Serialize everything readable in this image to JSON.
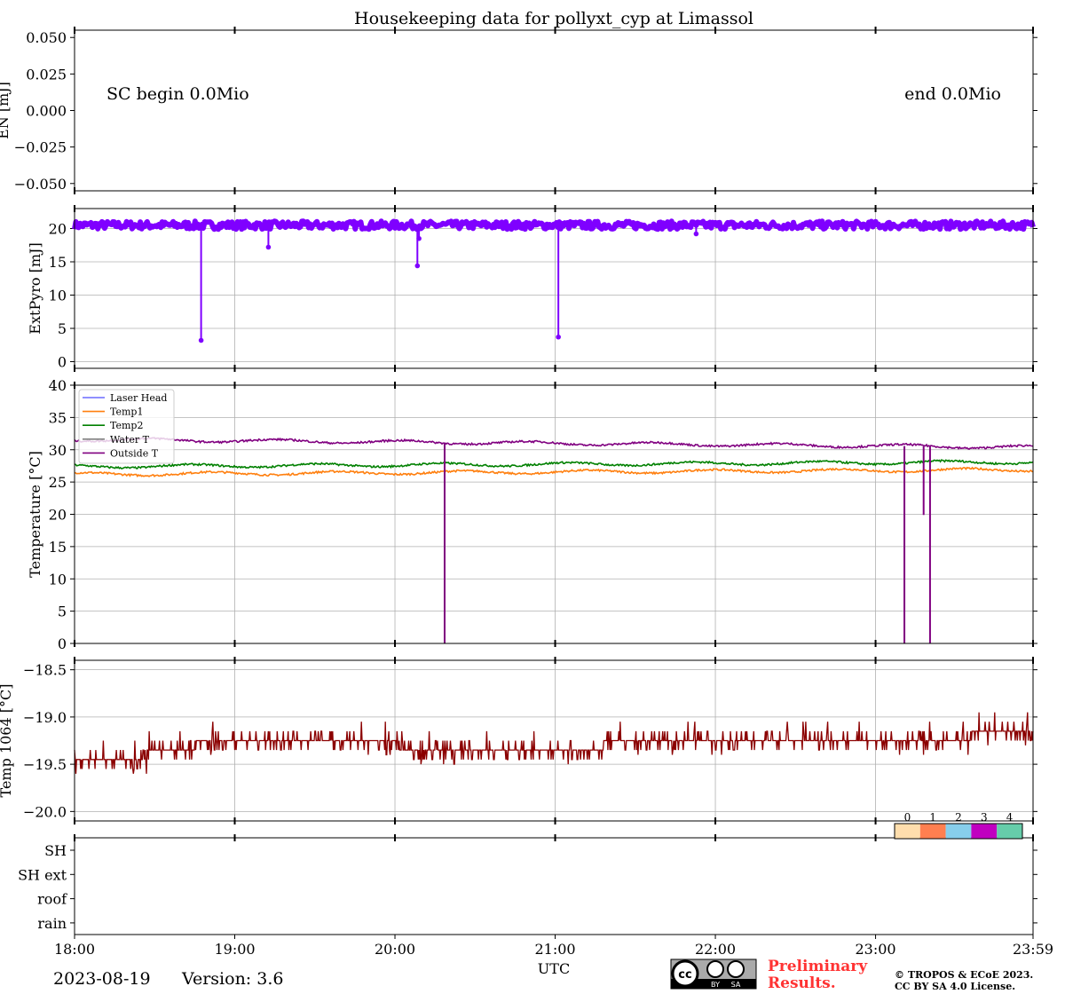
{
  "title": "Housekeeping data for pollyxt_cyp at Limassol",
  "date_label": "2023-08-19",
  "version_label": "Version: 3.6",
  "x_axis": {
    "label": "UTC",
    "ticks": [
      "18:00",
      "19:00",
      "20:00",
      "21:00",
      "22:00",
      "23:00",
      "23:59"
    ],
    "tick_hours": [
      18,
      19,
      20,
      21,
      22,
      23,
      23.983
    ],
    "range_hours": [
      18,
      23.983
    ]
  },
  "footer": {
    "preliminary": "Preliminary\nResults.",
    "copyright": "© TROPOS & ECoE 2023.",
    "license": "CC BY SA 4.0 License.",
    "cc_badge_by": "BY",
    "cc_badge_sa": "SA",
    "colors": {
      "preliminary": "#ff3333"
    }
  },
  "chart_data": [
    {
      "type": "line",
      "ylabel": "EN [mJ]",
      "ylim": [
        -0.055,
        0.055
      ],
      "yticks": [
        -0.05,
        -0.025,
        0.0,
        0.025,
        0.05
      ],
      "ytick_labels": [
        "−0.050",
        "−0.025",
        "0.000",
        "0.025",
        "0.050"
      ],
      "grid": false,
      "annotations": [
        "SC begin 0.0Mio",
        "end 0.0Mio"
      ],
      "series": []
    },
    {
      "type": "line",
      "ylabel": "ExtPyro [mJ]",
      "ylim": [
        -1,
        23
      ],
      "yticks": [
        0,
        5,
        10,
        15,
        20
      ],
      "ytick_labels": [
        "0",
        "5",
        "10",
        "15",
        "20"
      ],
      "grid": true,
      "color": "#7f00ff",
      "baseline": 20.5,
      "dips": [
        {
          "x": 18.79,
          "y": 3.2
        },
        {
          "x": 19.21,
          "y": 17.2
        },
        {
          "x": 20.14,
          "y": 14.4
        },
        {
          "x": 20.15,
          "y": 18.5
        },
        {
          "x": 21.02,
          "y": 3.7
        },
        {
          "x": 21.88,
          "y": 19.2
        }
      ]
    },
    {
      "type": "line",
      "ylabel": "Temperature [$^\\circ$C]",
      "ylim": [
        0,
        40
      ],
      "yticks": [
        0,
        5,
        10,
        15,
        20,
        25,
        30,
        35,
        40
      ],
      "ytick_labels": [
        "0",
        "5",
        "10",
        "15",
        "20",
        "25",
        "30",
        "35",
        "40"
      ],
      "grid": true,
      "legend_position": "top-left",
      "series": [
        {
          "name": "Laser Head",
          "color": "#6b6bff",
          "values": []
        },
        {
          "name": "Temp1",
          "color": "#ff7f0e",
          "start": 26.2,
          "end": 26.9
        },
        {
          "name": "Temp2",
          "color": "#008000",
          "start": 27.4,
          "end": 28.1
        },
        {
          "name": "Water T",
          "color": "#808080",
          "values": []
        },
        {
          "name": "Outside T",
          "color": "#800080",
          "start": 31.6,
          "end": 30.4,
          "dips": [
            {
              "x": 20.31,
              "y": 0
            },
            {
              "x": 23.18,
              "y": 0
            },
            {
              "x": 23.3,
              "y": 19.9
            },
            {
              "x": 23.34,
              "y": 0
            }
          ]
        }
      ]
    },
    {
      "type": "line",
      "ylabel": "Temp 1064 [$^\\circ$C]",
      "ylim": [
        -20.1,
        -18.4
      ],
      "yticks": [
        -20.0,
        -19.5,
        -19.0,
        -18.5
      ],
      "ytick_labels": [
        "−20.0",
        "−19.5",
        "−19.0",
        "−18.5"
      ],
      "grid": true,
      "color": "#8b0000",
      "levels": [
        {
          "from": 18.0,
          "to": 18.45,
          "value": -19.45
        },
        {
          "from": 18.45,
          "to": 18.75,
          "value": -19.35
        },
        {
          "from": 18.75,
          "to": 20.05,
          "value": -19.25
        },
        {
          "from": 20.05,
          "to": 21.3,
          "value": -19.35
        },
        {
          "from": 21.3,
          "to": 23.6,
          "value": -19.25
        },
        {
          "from": 23.6,
          "to": 23.98,
          "value": -19.15
        }
      ]
    },
    {
      "type": "heatmap",
      "categories": [
        "SH",
        "SH ext",
        "roof",
        "rain"
      ],
      "colorbar_ticks": [
        "0",
        "1",
        "2",
        "3",
        "4"
      ],
      "colorbar_colors": [
        "#ffdead",
        "#ff7f50",
        "#87ceeb",
        "#c000c0",
        "#66cdaa"
      ]
    }
  ]
}
